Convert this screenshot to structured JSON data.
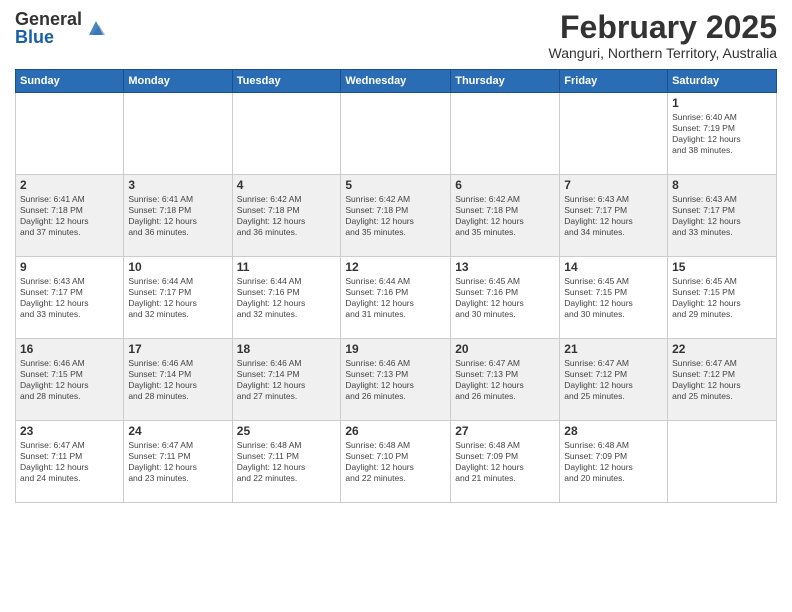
{
  "header": {
    "logo_general": "General",
    "logo_blue": "Blue",
    "month_title": "February 2025",
    "location": "Wanguri, Northern Territory, Australia"
  },
  "days_of_week": [
    "Sunday",
    "Monday",
    "Tuesday",
    "Wednesday",
    "Thursday",
    "Friday",
    "Saturday"
  ],
  "weeks": [
    {
      "shaded": false,
      "days": [
        {
          "num": "",
          "info": ""
        },
        {
          "num": "",
          "info": ""
        },
        {
          "num": "",
          "info": ""
        },
        {
          "num": "",
          "info": ""
        },
        {
          "num": "",
          "info": ""
        },
        {
          "num": "",
          "info": ""
        },
        {
          "num": "1",
          "info": "Sunrise: 6:40 AM\nSunset: 7:19 PM\nDaylight: 12 hours\nand 38 minutes."
        }
      ]
    },
    {
      "shaded": true,
      "days": [
        {
          "num": "2",
          "info": "Sunrise: 6:41 AM\nSunset: 7:18 PM\nDaylight: 12 hours\nand 37 minutes."
        },
        {
          "num": "3",
          "info": "Sunrise: 6:41 AM\nSunset: 7:18 PM\nDaylight: 12 hours\nand 36 minutes."
        },
        {
          "num": "4",
          "info": "Sunrise: 6:42 AM\nSunset: 7:18 PM\nDaylight: 12 hours\nand 36 minutes."
        },
        {
          "num": "5",
          "info": "Sunrise: 6:42 AM\nSunset: 7:18 PM\nDaylight: 12 hours\nand 35 minutes."
        },
        {
          "num": "6",
          "info": "Sunrise: 6:42 AM\nSunset: 7:18 PM\nDaylight: 12 hours\nand 35 minutes."
        },
        {
          "num": "7",
          "info": "Sunrise: 6:43 AM\nSunset: 7:17 PM\nDaylight: 12 hours\nand 34 minutes."
        },
        {
          "num": "8",
          "info": "Sunrise: 6:43 AM\nSunset: 7:17 PM\nDaylight: 12 hours\nand 33 minutes."
        }
      ]
    },
    {
      "shaded": false,
      "days": [
        {
          "num": "9",
          "info": "Sunrise: 6:43 AM\nSunset: 7:17 PM\nDaylight: 12 hours\nand 33 minutes."
        },
        {
          "num": "10",
          "info": "Sunrise: 6:44 AM\nSunset: 7:17 PM\nDaylight: 12 hours\nand 32 minutes."
        },
        {
          "num": "11",
          "info": "Sunrise: 6:44 AM\nSunset: 7:16 PM\nDaylight: 12 hours\nand 32 minutes."
        },
        {
          "num": "12",
          "info": "Sunrise: 6:44 AM\nSunset: 7:16 PM\nDaylight: 12 hours\nand 31 minutes."
        },
        {
          "num": "13",
          "info": "Sunrise: 6:45 AM\nSunset: 7:16 PM\nDaylight: 12 hours\nand 30 minutes."
        },
        {
          "num": "14",
          "info": "Sunrise: 6:45 AM\nSunset: 7:15 PM\nDaylight: 12 hours\nand 30 minutes."
        },
        {
          "num": "15",
          "info": "Sunrise: 6:45 AM\nSunset: 7:15 PM\nDaylight: 12 hours\nand 29 minutes."
        }
      ]
    },
    {
      "shaded": true,
      "days": [
        {
          "num": "16",
          "info": "Sunrise: 6:46 AM\nSunset: 7:15 PM\nDaylight: 12 hours\nand 28 minutes."
        },
        {
          "num": "17",
          "info": "Sunrise: 6:46 AM\nSunset: 7:14 PM\nDaylight: 12 hours\nand 28 minutes."
        },
        {
          "num": "18",
          "info": "Sunrise: 6:46 AM\nSunset: 7:14 PM\nDaylight: 12 hours\nand 27 minutes."
        },
        {
          "num": "19",
          "info": "Sunrise: 6:46 AM\nSunset: 7:13 PM\nDaylight: 12 hours\nand 26 minutes."
        },
        {
          "num": "20",
          "info": "Sunrise: 6:47 AM\nSunset: 7:13 PM\nDaylight: 12 hours\nand 26 minutes."
        },
        {
          "num": "21",
          "info": "Sunrise: 6:47 AM\nSunset: 7:12 PM\nDaylight: 12 hours\nand 25 minutes."
        },
        {
          "num": "22",
          "info": "Sunrise: 6:47 AM\nSunset: 7:12 PM\nDaylight: 12 hours\nand 25 minutes."
        }
      ]
    },
    {
      "shaded": false,
      "days": [
        {
          "num": "23",
          "info": "Sunrise: 6:47 AM\nSunset: 7:11 PM\nDaylight: 12 hours\nand 24 minutes."
        },
        {
          "num": "24",
          "info": "Sunrise: 6:47 AM\nSunset: 7:11 PM\nDaylight: 12 hours\nand 23 minutes."
        },
        {
          "num": "25",
          "info": "Sunrise: 6:48 AM\nSunset: 7:11 PM\nDaylight: 12 hours\nand 22 minutes."
        },
        {
          "num": "26",
          "info": "Sunrise: 6:48 AM\nSunset: 7:10 PM\nDaylight: 12 hours\nand 22 minutes."
        },
        {
          "num": "27",
          "info": "Sunrise: 6:48 AM\nSunset: 7:09 PM\nDaylight: 12 hours\nand 21 minutes."
        },
        {
          "num": "28",
          "info": "Sunrise: 6:48 AM\nSunset: 7:09 PM\nDaylight: 12 hours\nand 20 minutes."
        },
        {
          "num": "",
          "info": ""
        }
      ]
    }
  ]
}
